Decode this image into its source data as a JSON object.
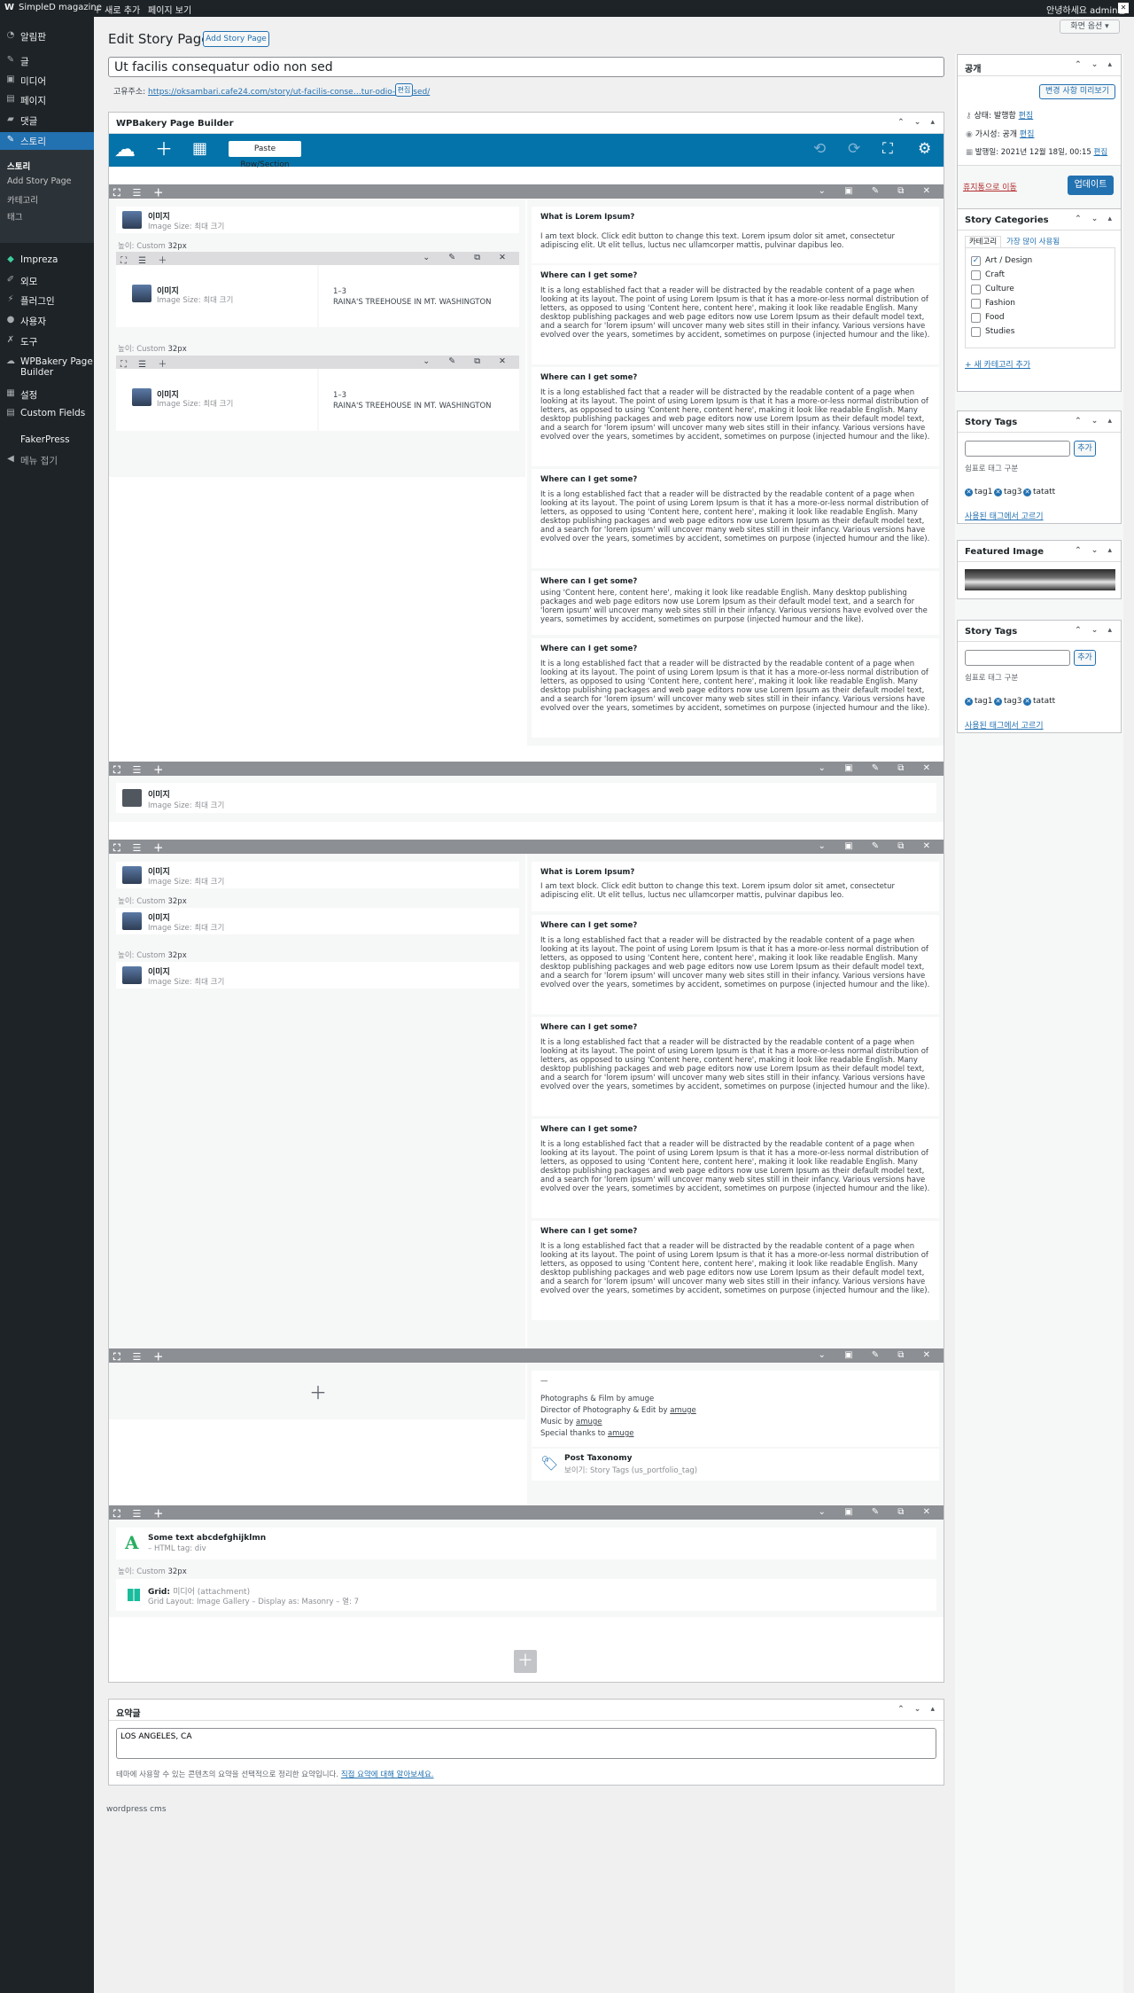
{
  "adminbar": {
    "wp_logo": "W",
    "site": "SimpleD magazine",
    "new": "＋ 새로 추가",
    "view": "페이지 보기",
    "howdy": "안녕하세요 admin님"
  },
  "sidebar": {
    "items": [
      {
        "label": "알림판",
        "icon": "dashboard-icon"
      },
      {
        "label": "글",
        "icon": "pin-icon"
      },
      {
        "label": "미디어",
        "icon": "media-icon"
      },
      {
        "label": "페이지",
        "icon": "page-icon"
      },
      {
        "label": "댓글",
        "icon": "comment-icon"
      },
      {
        "label": "스토리",
        "icon": "pin-icon"
      }
    ],
    "submenu": [
      "스토리",
      "Add Story Page",
      "카테고리",
      "태그"
    ],
    "items2": [
      {
        "label": "Impreza",
        "icon": "diamond-icon"
      },
      {
        "label": "외모",
        "icon": "brush-icon"
      },
      {
        "label": "플러그인",
        "icon": "plugin-icon"
      },
      {
        "label": "사용자",
        "icon": "user-icon"
      },
      {
        "label": "도구",
        "icon": "wrench-icon"
      },
      {
        "label": "WPBakery Page",
        "label2": "Builder",
        "icon": "cloud-icon"
      },
      {
        "label": "설정",
        "icon": "settings-icon"
      },
      {
        "label": "Custom Fields",
        "icon": "fields-icon"
      },
      {
        "label": "FakerPress",
        "icon": ""
      },
      {
        "label": "메뉴 접기",
        "icon": "collapse-icon"
      }
    ]
  },
  "screen_options": "화면 옵션 ▾",
  "header": {
    "title": "Edit Story Page",
    "add_button": "Add Story Page"
  },
  "post_title": "Ut facilis consequatur odio non sed",
  "permalink": {
    "label": "고유주소:",
    "url": "https://oksambari.cafe24.com/story/ut-facilis-conse…tur-odio-non-sed/",
    "edit": "편집"
  },
  "wpb": {
    "box_title": "WPBakery Page Builder",
    "paste": "Paste Row/Section",
    "logo": "☁",
    "add": "＋",
    "template": "▦",
    "undo": "⟲",
    "redo": "⟳",
    "fullscreen": "⛶",
    "settings": "⚙"
  },
  "builder": {
    "row_left": "⛶ ☰ ＋",
    "row_right": "⌄ ▣ ✎ ⧉ ✕",
    "inner_left": "⛶ ☰ ＋",
    "inner_right": "⌄ ✎ ⧉ ✕",
    "image_title": "이미지",
    "image_sub": "Image Size: 최대 크기",
    "height_label": "높이: Custom",
    "height_value": "32px",
    "inner_heading": "1–3",
    "inner_text": "RAINA'S TREEHOUSE IN MT. WASHINGTON",
    "text_q1": "What is Lorem Ipsum?",
    "text_a1": "I am text block. Click edit button to change this text. Lorem ipsum dolor sit amet, consectetur adipiscing elit. Ut elit tellus, luctus nec ullamcorper mattis, pulvinar dapibus leo.",
    "text_q2": "Where can I get some?",
    "text_a2": "It is a long established fact that a reader will be distracted by the readable content of a page when looking at its layout. The point of using Lorem Ipsum is that it has a more-or-less normal distribution of letters, as opposed to using 'Content here, content here', making it look like readable English. Many desktop publishing packages and web page editors now use Lorem Ipsum as their default model text, and a search for 'lorem ipsum' will uncover many web sites still in their infancy. Various versions have evolved over the years, sometimes by accident, sometimes on purpose (injected humour and the like).",
    "text_a2_clipped": "using 'Content here, content here', making it look like readable English. Many desktop publishing packages and web page editors now use Lorem Ipsum as their default model text, and a search for 'lorem ipsum' will uncover many web sites still in their infancy. Various versions have evolved over the years, sometimes by accident, sometimes on purpose (injected humour and the like).",
    "credits_dash": "—",
    "credit1": "Photographs & Film by amuge",
    "credit2a": "Director of Photography & Edit by ",
    "credit2b": "amuge",
    "credit3a": "Music by ",
    "credit3b": "amuge",
    "credit4a": "Special thanks to ",
    "credit4b": "amuge",
    "taxonomy_title": "Post Taxonomy",
    "taxonomy_sub": "보이기: Story Tags (us_portfolio_tag)",
    "some_text_title": "Some text abcdefghijklmn",
    "some_text_sub": "– HTML tag: div",
    "grid_title_a": "Grid: ",
    "grid_title_b": "미디어 (attachment)",
    "grid_sub": "Grid Layout: Image Gallery – Display as: Masonry – 열: 7",
    "add_row": "＋",
    "empty_add": "＋"
  },
  "excerpt": {
    "title": "요약글",
    "value": "LOS ANGELES, CA",
    "help_a": "테마에 사용할 수 있는 콘텐츠의 요약을 선택적으로 정리한 요약입니다. ",
    "help_b": "직접 요약에 대해 알아보세요."
  },
  "footer": "wordpress cms",
  "publish": {
    "title": "공개",
    "preview": "변경 사항 미리보기",
    "status": "상태: 발행함",
    "visibility": "가시성: 공개",
    "date": "발행일: 2021년 12월 18일, 00:15",
    "edit": "편집",
    "trash": "휴지통으로 이동",
    "update": "업데이트"
  },
  "categories": {
    "title": "Story Categories",
    "tab_all": "카테고리",
    "tab_popular": "가장 많이 사용됨",
    "items": [
      {
        "label": "Art / Design",
        "checked": true
      },
      {
        "label": "Craft",
        "checked": false
      },
      {
        "label": "Culture",
        "checked": false
      },
      {
        "label": "Fashion",
        "checked": false
      },
      {
        "label": "Food",
        "checked": false
      },
      {
        "label": "Studies",
        "checked": false
      }
    ],
    "add": "+ 새 카테고리 추가"
  },
  "tags1": {
    "title": "Story Tags",
    "add": "추가",
    "hint": "쉼표로 태그 구분",
    "tags": [
      "tag1",
      "tag3",
      "tatatt"
    ],
    "choose": "사용된 태그에서 고르기"
  },
  "featured": {
    "title": "Featured Image"
  },
  "tags2": {
    "title": "Story Tags",
    "add": "추가",
    "hint": "쉼표로 태그 구분",
    "tags": [
      "tag1",
      "tag3",
      "tatatt"
    ],
    "choose": "사용된 태그에서 고르기"
  },
  "box_controls": "⌃ ⌄ ▴"
}
